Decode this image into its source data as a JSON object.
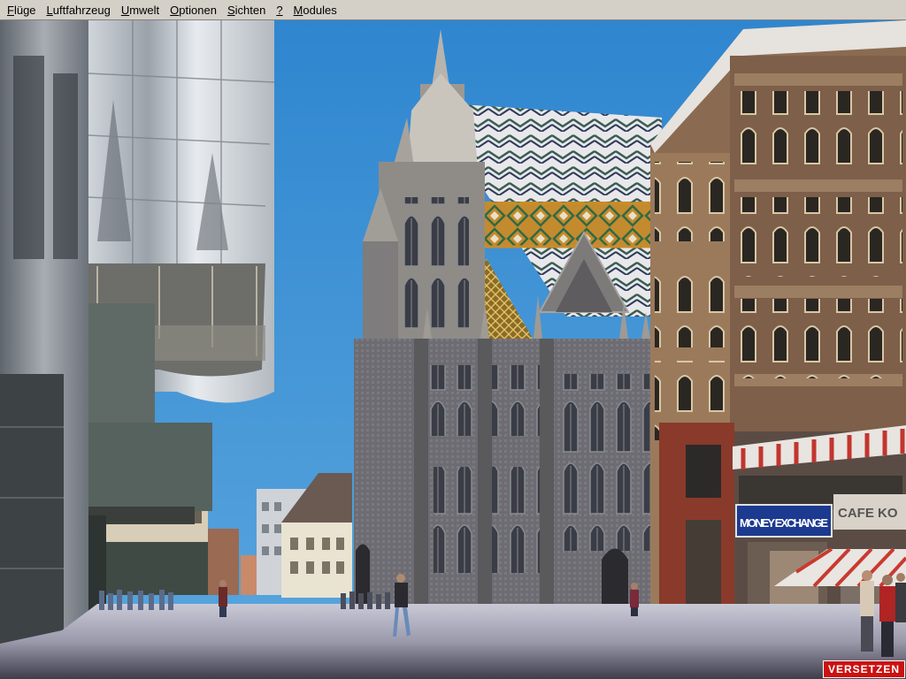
{
  "menu": {
    "items": [
      {
        "label": "Flüge",
        "accel": "F",
        "rest": "lüge"
      },
      {
        "label": "Luftfahrzeug",
        "accel": "L",
        "rest": "uftfahrzeug"
      },
      {
        "label": "Umwelt",
        "accel": "U",
        "rest": "mwelt"
      },
      {
        "label": "Optionen",
        "accel": "O",
        "rest": "ptionen"
      },
      {
        "label": "Sichten",
        "accel": "S",
        "rest": "ichten"
      },
      {
        "label": "?",
        "accel": "?",
        "rest": ""
      },
      {
        "label": "Modules",
        "accel": "M",
        "rest": "odules"
      }
    ]
  },
  "scene": {
    "signs": {
      "money_exchange": "MONEY EXCHANGE",
      "cafe": "CAFE KO"
    }
  },
  "status": {
    "label": "VERSETZEN"
  },
  "colors": {
    "menubar": "#d4d0c8",
    "sky": "#3a8fd0",
    "status_badge": "#cc1111"
  }
}
